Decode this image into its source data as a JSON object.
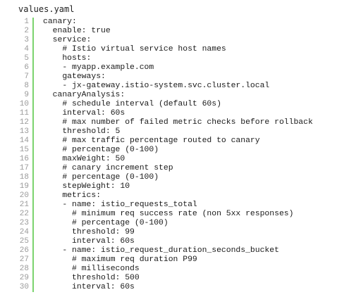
{
  "file": {
    "name": "values.yaml"
  },
  "code": {
    "lines": [
      {
        "num": "1",
        "text": "canary:"
      },
      {
        "num": "2",
        "text": "  enable: true"
      },
      {
        "num": "3",
        "text": "  service:"
      },
      {
        "num": "4",
        "text": "    # Istio virtual service host names"
      },
      {
        "num": "5",
        "text": "    hosts:"
      },
      {
        "num": "6",
        "text": "    - myapp.example.com"
      },
      {
        "num": "7",
        "text": "    gateways:"
      },
      {
        "num": "8",
        "text": "    - jx-gateway.istio-system.svc.cluster.local"
      },
      {
        "num": "9",
        "text": "  canaryAnalysis:"
      },
      {
        "num": "10",
        "text": "    # schedule interval (default 60s)"
      },
      {
        "num": "11",
        "text": "    interval: 60s"
      },
      {
        "num": "12",
        "text": "    # max number of failed metric checks before rollback"
      },
      {
        "num": "13",
        "text": "    threshold: 5"
      },
      {
        "num": "14",
        "text": "    # max traffic percentage routed to canary"
      },
      {
        "num": "15",
        "text": "    # percentage (0-100)"
      },
      {
        "num": "16",
        "text": "    maxWeight: 50"
      },
      {
        "num": "17",
        "text": "    # canary increment step"
      },
      {
        "num": "18",
        "text": "    # percentage (0-100)"
      },
      {
        "num": "19",
        "text": "    stepWeight: 10"
      },
      {
        "num": "20",
        "text": "    metrics:"
      },
      {
        "num": "21",
        "text": "    - name: istio_requests_total"
      },
      {
        "num": "22",
        "text": "      # minimum req success rate (non 5xx responses)"
      },
      {
        "num": "23",
        "text": "      # percentage (0-100)"
      },
      {
        "num": "24",
        "text": "      threshold: 99"
      },
      {
        "num": "25",
        "text": "      interval: 60s"
      },
      {
        "num": "26",
        "text": "    - name: istio_request_duration_seconds_bucket"
      },
      {
        "num": "27",
        "text": "      # maximum req duration P99"
      },
      {
        "num": "28",
        "text": "      # milliseconds"
      },
      {
        "num": "29",
        "text": "      threshold: 500"
      },
      {
        "num": "30",
        "text": "      interval: 60s"
      }
    ]
  },
  "colors": {
    "gutter": "#7cd36e",
    "line_number": "#9a9a9a",
    "text": "#1a1a1a"
  }
}
